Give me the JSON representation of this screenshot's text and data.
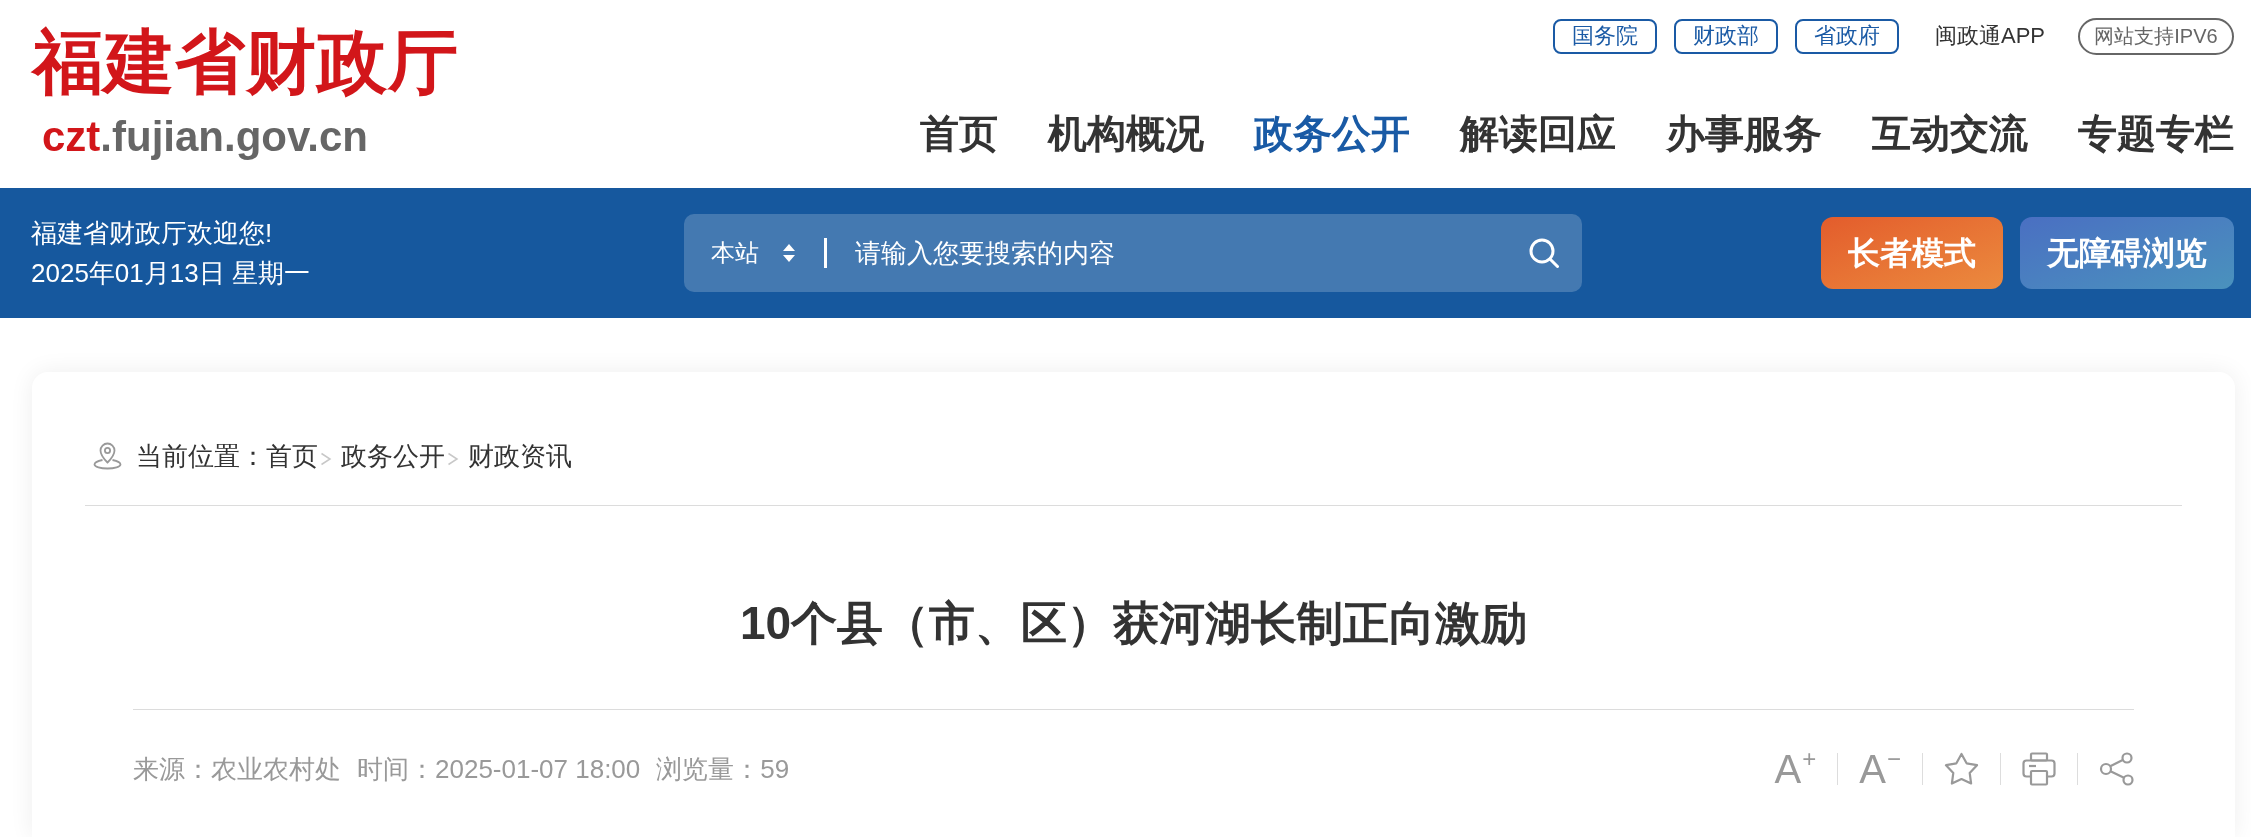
{
  "header": {
    "logo": {
      "name": "福建省财政厅",
      "domain_highlight": "czt",
      "domain_rest": ".fujian.gov.cn"
    },
    "top_links": [
      {
        "label": "国务院",
        "kind": "boxed"
      },
      {
        "label": "财政部",
        "kind": "boxed"
      },
      {
        "label": "省政府",
        "kind": "boxed"
      },
      {
        "label": "闽政通APP",
        "kind": "plain"
      },
      {
        "label": "网站支持IPV6",
        "kind": "pill"
      }
    ],
    "nav": [
      {
        "label": "首页",
        "selected": false
      },
      {
        "label": "机构概况",
        "selected": false
      },
      {
        "label": "政务公开",
        "selected": true
      },
      {
        "label": "解读回应",
        "selected": false
      },
      {
        "label": "办事服务",
        "selected": false
      },
      {
        "label": "互动交流",
        "selected": false
      },
      {
        "label": "专题专栏",
        "selected": false
      }
    ]
  },
  "banner": {
    "welcome": "福建省财政厅欢迎您!",
    "date": "2025年01月13日 星期一",
    "search": {
      "scope": "本站",
      "placeholder": "请输入您要搜索的内容"
    },
    "buttons": [
      {
        "label": "长者模式",
        "kind": "elder"
      },
      {
        "label": "无障碍浏览",
        "kind": "accessible"
      }
    ]
  },
  "article": {
    "breadcrumb": {
      "label": "当前位置：",
      "items": [
        "首页",
        "政务公开",
        "财政资讯"
      ]
    },
    "title": "10个县（市、区）获河湖长制正向激励",
    "meta": [
      "来源：农业农村处",
      "时间：2025-01-07 18:00",
      "浏览量：59"
    ],
    "tools": [
      {
        "kind": "text",
        "label": "A$^{+}$"
      },
      {
        "kind": "text",
        "label": "A$^{−}$"
      },
      {
        "kind": "star"
      },
      {
        "kind": "print"
      },
      {
        "kind": "share"
      }
    ]
  }
}
